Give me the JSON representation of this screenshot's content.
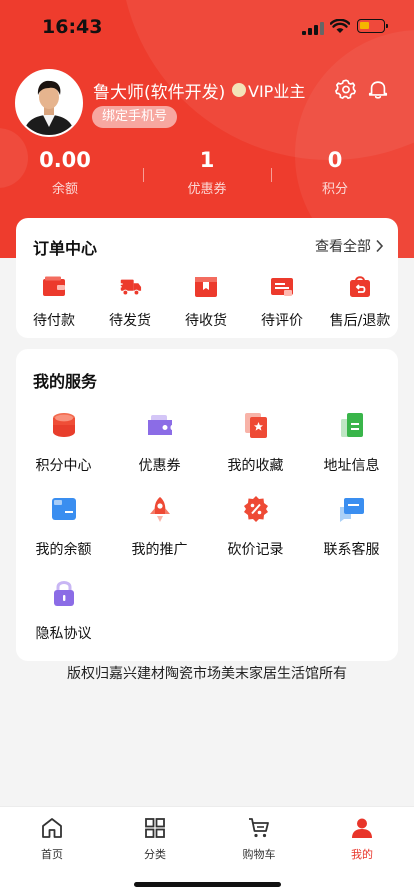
{
  "status_bar": {
    "time": "16:43"
  },
  "profile": {
    "username": "鲁大师(软件开发)",
    "vip_label": "VIP业主",
    "bind_phone_label": "绑定手机号"
  },
  "stats": [
    {
      "value": "0.00",
      "label": "余额"
    },
    {
      "value": "1",
      "label": "优惠券"
    },
    {
      "value": "0",
      "label": "积分"
    }
  ],
  "orders": {
    "title": "订单中心",
    "view_all_label": "查看全部",
    "items": [
      {
        "label": "待付款",
        "icon": "wallet-icon"
      },
      {
        "label": "待发货",
        "icon": "truck-icon"
      },
      {
        "label": "待收货",
        "icon": "package-icon"
      },
      {
        "label": "待评价",
        "icon": "review-icon"
      },
      {
        "label": "售后/退款",
        "icon": "refund-bag-icon"
      }
    ]
  },
  "services": {
    "title": "我的服务",
    "items": [
      {
        "label": "积分中心",
        "icon": "coins-icon"
      },
      {
        "label": "优惠券",
        "icon": "coupon-icon"
      },
      {
        "label": "我的收藏",
        "icon": "star-card-icon"
      },
      {
        "label": "地址信息",
        "icon": "address-book-icon"
      },
      {
        "label": "我的余额",
        "icon": "card-icon"
      },
      {
        "label": "我的推广",
        "icon": "rocket-icon"
      },
      {
        "label": "砍价记录",
        "icon": "discount-icon"
      },
      {
        "label": "联系客服",
        "icon": "chat-icon"
      },
      {
        "label": "隐私协议",
        "icon": "lock-icon"
      }
    ]
  },
  "copyright": "版权归嘉兴建材陶瓷市场美末家居生活馆所有",
  "tabbar": {
    "items": [
      {
        "label": "首页",
        "icon": "home-icon"
      },
      {
        "label": "分类",
        "icon": "grid-icon"
      },
      {
        "label": "购物车",
        "icon": "cart-icon"
      },
      {
        "label": "我的",
        "icon": "person-icon"
      }
    ],
    "active_index": 3
  },
  "colors": {
    "brand_red": "#ee3c2d",
    "tab_active": "#e8352a",
    "battery": "#f5b400"
  }
}
